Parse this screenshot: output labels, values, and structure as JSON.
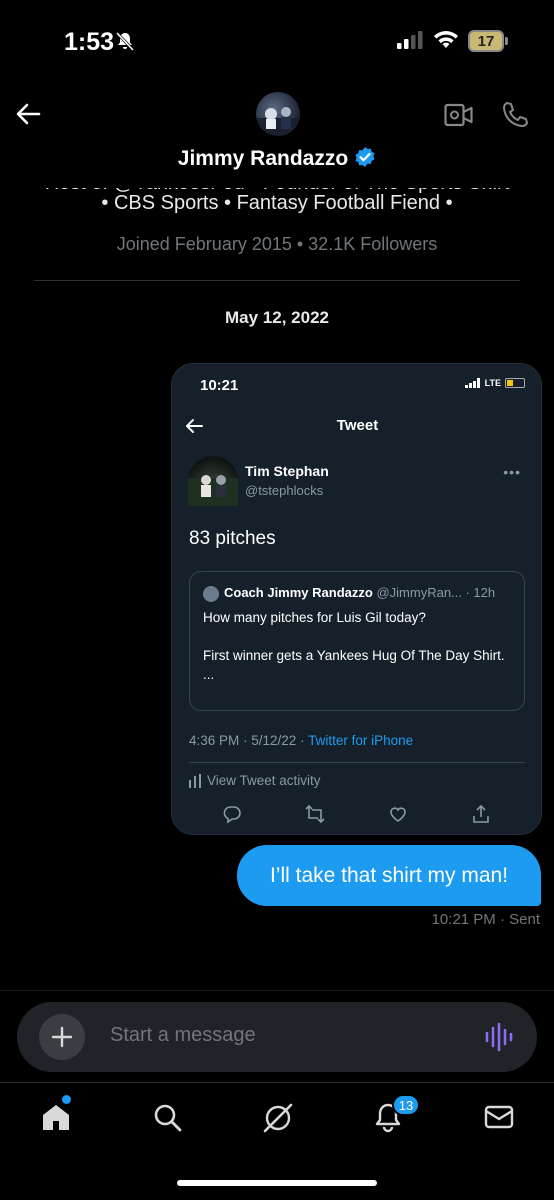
{
  "status_bar": {
    "time": "1:53",
    "battery": "17"
  },
  "header": {
    "name": "Jimmy Randazzo",
    "verified": true
  },
  "profile": {
    "bio_cut": "Host of @YankeesFed • Founder of The Sports Shirt",
    "bio_line2": "• CBS Sports • Fantasy Football Fiend •",
    "joined": "Joined February 2015 • 32.1K Followers"
  },
  "conversation": {
    "date": "May 12, 2022"
  },
  "tweet_card": {
    "time": "10:21",
    "network": "LTE",
    "title": "Tweet",
    "author_name": "Tim Stephan",
    "author_handle": "@tstephlocks",
    "body": "83 pitches",
    "quote_author": "Coach Jimmy Randazzo",
    "quote_meta": "@JimmyRan... · 12h",
    "quote_text": "How many pitches for Luis Gil today?\n\nFirst winner gets a Yankees Hug Of The Day Shirt.\n...",
    "meta_time": "4:36 PM · 5/12/22 · ",
    "meta_source": "Twitter for iPhone",
    "activity": "View Tweet activity"
  },
  "message": {
    "text": "I’ll take that shirt my man!",
    "meta": "10:21 PM · Sent"
  },
  "composer": {
    "placeholder": "Start a message"
  },
  "nav": {
    "notifications_badge": "13"
  },
  "colors": {
    "accent": "#1d9bf0",
    "background": "#000000",
    "card": "#15202b",
    "voice": "#8c6cf0"
  }
}
